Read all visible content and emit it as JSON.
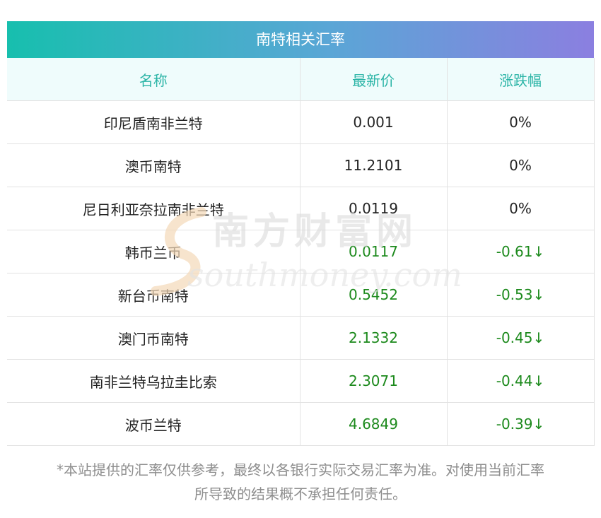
{
  "title": "南特相关汇率",
  "columns": [
    "名称",
    "最新价",
    "涨跌幅"
  ],
  "rows": [
    {
      "name": "印尼盾南非兰特",
      "price": "0.001",
      "change": "0%",
      "trend": "flat"
    },
    {
      "name": "澳币南特",
      "price": "11.2101",
      "change": "0%",
      "trend": "flat"
    },
    {
      "name": "尼日利亚奈拉南非兰特",
      "price": "0.0119",
      "change": "0%",
      "trend": "flat"
    },
    {
      "name": "韩币兰币",
      "price": "0.0117",
      "change": "-0.61↓",
      "trend": "down"
    },
    {
      "name": "新台币南特",
      "price": "0.5452",
      "change": "-0.53↓",
      "trend": "down"
    },
    {
      "name": "澳门币南特",
      "price": "2.1332",
      "change": "-0.45↓",
      "trend": "down"
    },
    {
      "name": "南非兰特乌拉圭比索",
      "price": "2.3071",
      "change": "-0.44↓",
      "trend": "down"
    },
    {
      "name": "波币兰特",
      "price": "4.6849",
      "change": "-0.39↓",
      "trend": "down"
    }
  ],
  "watermark": {
    "cn": "南方财富网",
    "en": "southmoney.com"
  },
  "disclaimer_line1": "*本站提供的汇率仅供参考，最终以各银行实际交易汇率为准。对使用当前汇率",
  "disclaimer_line2": "所导致的结果概不承担任何责任。",
  "colors": {
    "header_start": "#17bfae",
    "header_end": "#8b7fe0",
    "header_text": "#2ab4a6",
    "down": "#1d8a1d"
  }
}
